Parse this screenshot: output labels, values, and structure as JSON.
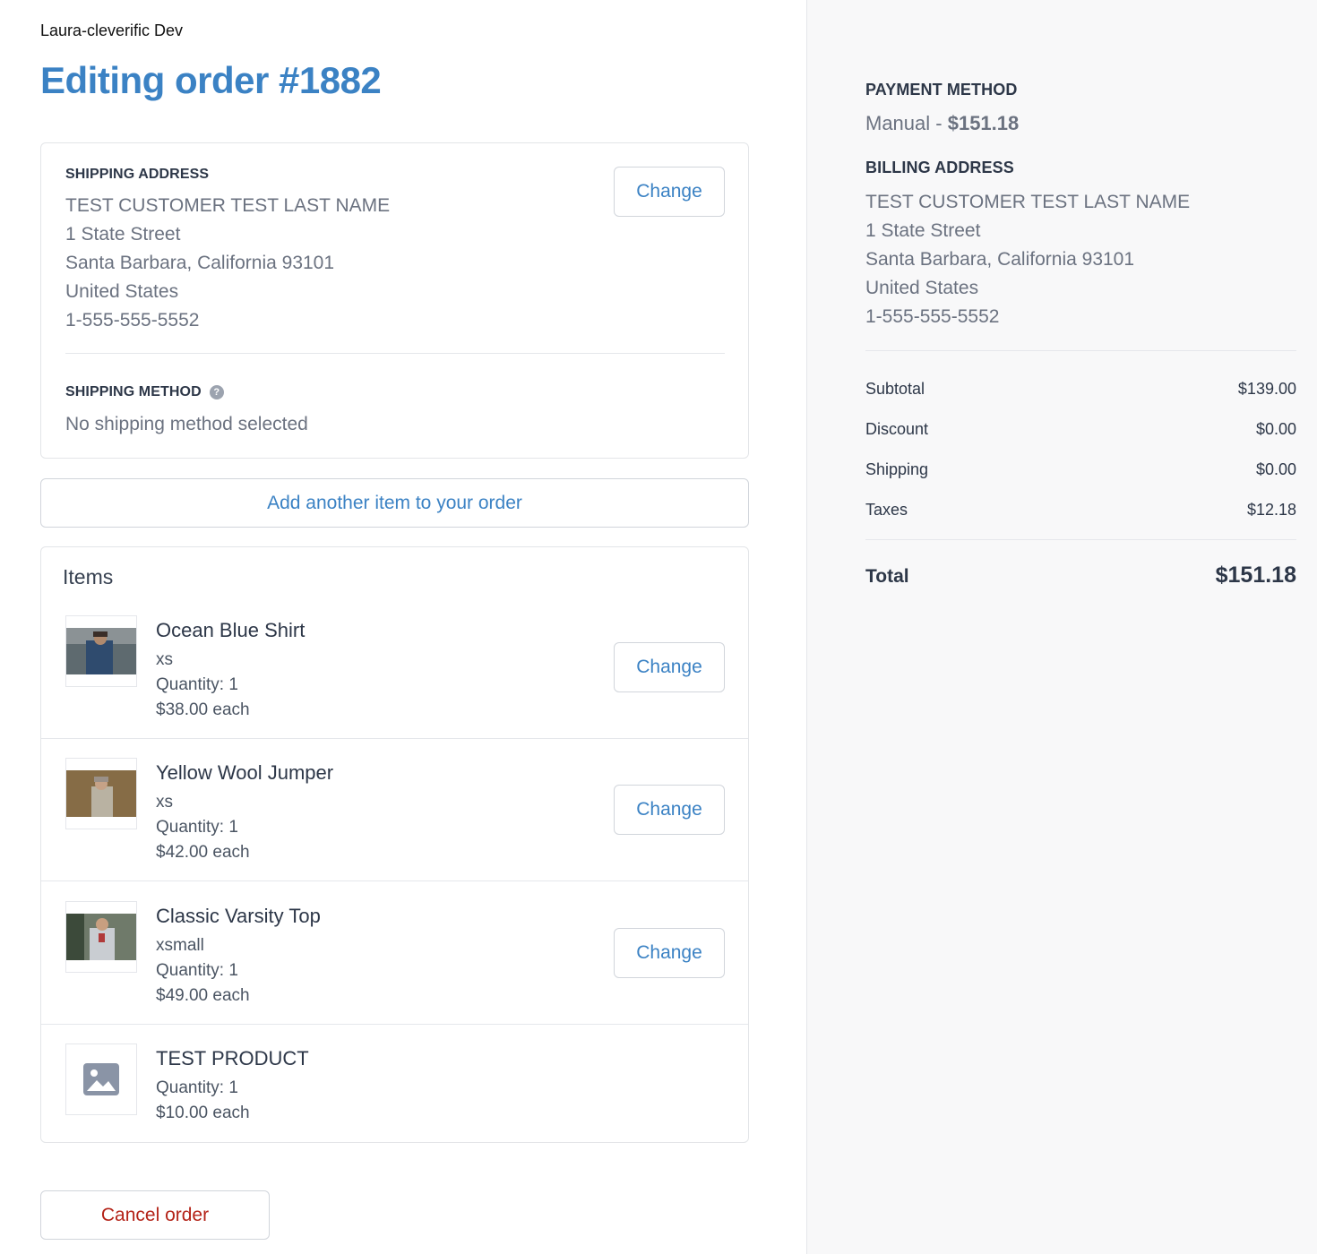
{
  "store_name": "Laura-cleverific Dev",
  "page_title": "Editing order #1882",
  "shipping_address": {
    "label": "SHIPPING ADDRESS",
    "lines": [
      "TEST CUSTOMER TEST LAST NAME",
      "1 State Street",
      "Santa Barbara, California 93101",
      "United States",
      "1-555-555-5552"
    ],
    "change_label": "Change"
  },
  "shipping_method": {
    "label": "SHIPPING METHOD",
    "help_icon": "question-circle-icon",
    "help_glyph": "?",
    "value": "No shipping method selected"
  },
  "add_item_label": "Add another item to your order",
  "items_section": {
    "title": "Items",
    "items": [
      {
        "name": "Ocean Blue Shirt",
        "variant": "xs",
        "quantity": "Quantity: 1",
        "price": "$38.00 each",
        "change_label": "Change",
        "image": "product-photo"
      },
      {
        "name": "Yellow Wool Jumper",
        "variant": "xs",
        "quantity": "Quantity: 1",
        "price": "$42.00 each",
        "change_label": "Change",
        "image": "product-photo"
      },
      {
        "name": "Classic Varsity Top",
        "variant": "xsmall",
        "quantity": "Quantity: 1",
        "price": "$49.00 each",
        "change_label": "Change",
        "image": "product-photo"
      },
      {
        "name": "TEST PRODUCT",
        "quantity": "Quantity: 1",
        "price": "$10.00 each",
        "image": "image-placeholder-icon"
      }
    ]
  },
  "cancel_label": "Cancel order",
  "payment": {
    "label": "PAYMENT METHOD",
    "method": "Manual - ",
    "amount": "$151.18"
  },
  "billing_address": {
    "label": "BILLING ADDRESS",
    "lines": [
      "TEST CUSTOMER TEST LAST NAME",
      "1 State Street",
      "Santa Barbara, California 93101",
      "United States",
      "1-555-555-5552"
    ]
  },
  "summary": {
    "rows": [
      {
        "label": "Subtotal",
        "value": "$139.00"
      },
      {
        "label": "Discount",
        "value": "$0.00"
      },
      {
        "label": "Shipping",
        "value": "$0.00"
      },
      {
        "label": "Taxes",
        "value": "$12.18"
      }
    ],
    "total_label": "Total",
    "total_value": "$151.18"
  },
  "colors": {
    "accent": "#3b82c4",
    "danger": "#b42318",
    "sidebar_bg": "#f8f8f9"
  }
}
